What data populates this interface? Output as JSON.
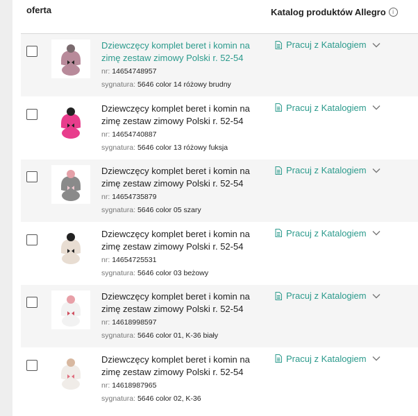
{
  "header": {
    "col_offer": "oferta",
    "col_catalog": "Katalog produktów Allegro",
    "info_icon": "info-icon"
  },
  "labels": {
    "nr": "nr:",
    "sygnatura": "sygnatura:"
  },
  "rows": [
    {
      "title": "Dziewczęcy komplet beret i komin na zimę zestaw zimowy Polski r. 52-54",
      "nr": "14654748957",
      "sygnatura": "5646 color 14 różowy brudny",
      "catalog_action": "Pracuj z Katalogiem",
      "product_color": "#b88a9a",
      "pompom_color": "#7a6a6e",
      "bow_color": "#222222"
    },
    {
      "title": "Dziewczęcy komplet beret i komin na zimę zestaw zimowy Polski r. 52-54",
      "nr": "14654740887",
      "sygnatura": "5646 color 13 różowy fuksja",
      "catalog_action": "Pracuj z Katalogiem",
      "product_color": "#e83d8c",
      "pompom_color": "#222222",
      "bow_color": "#222222"
    },
    {
      "title": "Dziewczęcy komplet beret i komin na zimę zestaw zimowy Polski r. 52-54",
      "nr": "14654735879",
      "sygnatura": "5646 color 05 szary",
      "catalog_action": "Pracuj z Katalogiem",
      "product_color": "#8a8a8a",
      "pompom_color": "#e5a0a8",
      "bow_color": "#f0c8d0"
    },
    {
      "title": "Dziewczęcy komplet beret i komin na zimę zestaw zimowy Polski r. 52-54",
      "nr": "14654725531",
      "sygnatura": "5646 color 03 beżowy",
      "catalog_action": "Pracuj z Katalogiem",
      "product_color": "#e8ddd2",
      "pompom_color": "#222222",
      "bow_color": "#222222"
    },
    {
      "title": "Dziewczęcy komplet beret i komin na zimę zestaw zimowy Polski r. 52-54",
      "nr": "14618998597",
      "sygnatura": "5646 color 01, K-36 biały",
      "catalog_action": "Pracuj z Katalogiem",
      "product_color": "#f2f2f2",
      "pompom_color": "#e8a0a8",
      "bow_color": "#d05060"
    },
    {
      "title": "Dziewczęcy komplet beret i komin na zimę zestaw zimowy Polski r. 52-54",
      "nr": "14618987965",
      "sygnatura": "5646 color 02, K-36",
      "catalog_action": "Pracuj z Katalogiem",
      "product_color": "#f0ece8",
      "pompom_color": "#d8b8a0",
      "bow_color": "#e07080"
    }
  ],
  "colors": {
    "accent": "#2b9a8c",
    "row_alt": "#f5f5f5"
  }
}
